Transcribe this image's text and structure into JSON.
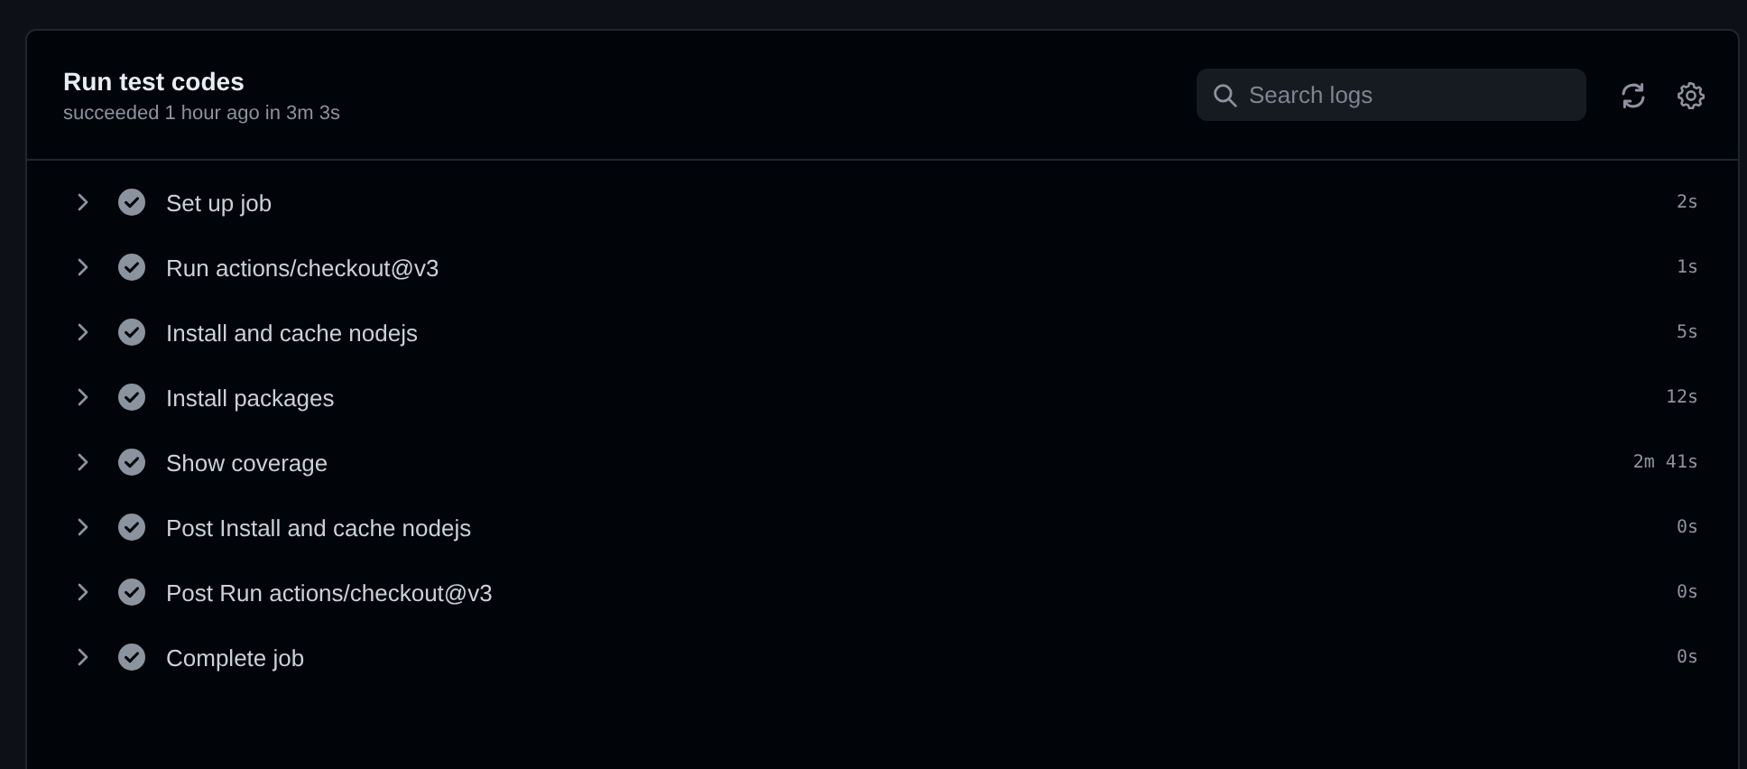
{
  "job": {
    "title": "Run test codes",
    "summary": "succeeded 1 hour ago in 3m 3s"
  },
  "search": {
    "placeholder": "Search logs"
  },
  "steps": [
    {
      "name": "Set up job",
      "kind": "success",
      "expanded": false,
      "duration": "2s"
    },
    {
      "name": "Run actions/checkout@v3",
      "kind": "success",
      "expanded": false,
      "duration": "1s"
    },
    {
      "name": "Install and cache nodejs",
      "kind": "success",
      "expanded": false,
      "duration": "5s"
    },
    {
      "name": "Install packages",
      "kind": "success",
      "expanded": false,
      "duration": "12s"
    },
    {
      "name": "Show coverage",
      "kind": "success",
      "expanded": false,
      "duration": "2m 41s"
    },
    {
      "name": "Post Install and cache nodejs",
      "kind": "success",
      "expanded": false,
      "duration": "0s"
    },
    {
      "name": "Post Run actions/checkout@v3",
      "kind": "success",
      "expanded": false,
      "duration": "0s"
    },
    {
      "name": "Complete job",
      "kind": "success",
      "expanded": false,
      "duration": "0s"
    }
  ]
}
